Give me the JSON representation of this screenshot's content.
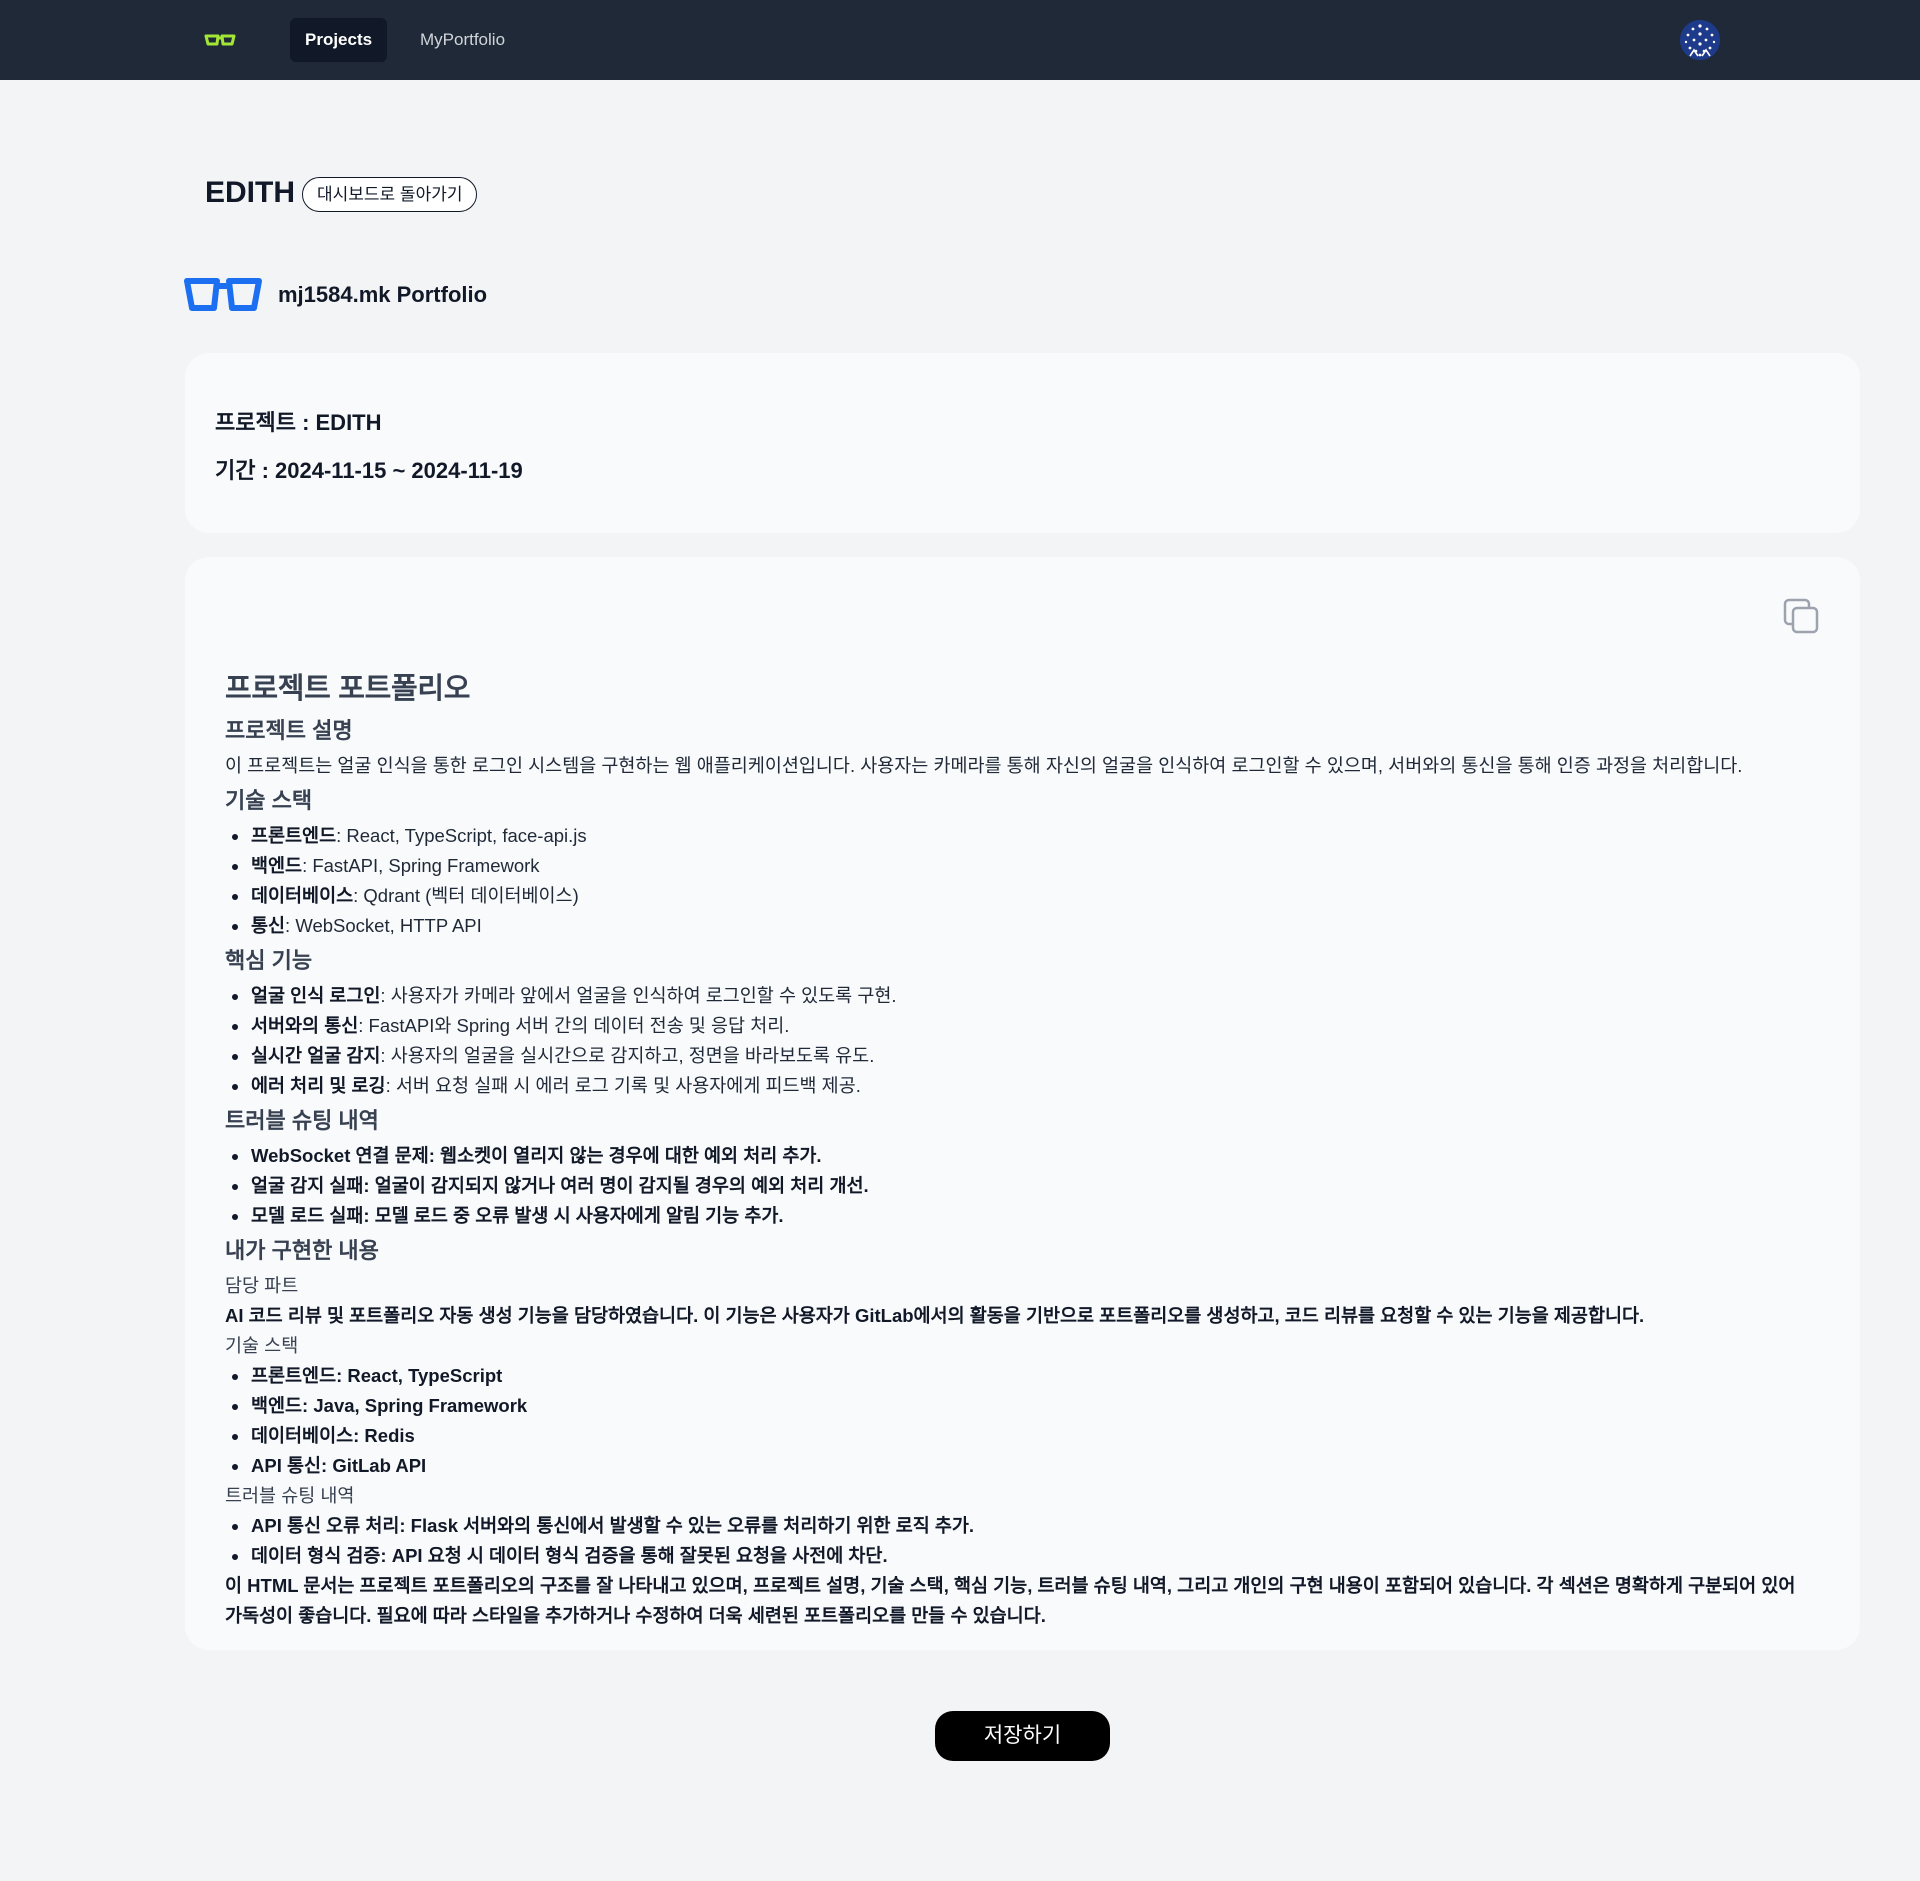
{
  "nav": {
    "tabs": [
      {
        "label": "Projects",
        "active": true
      },
      {
        "label": "MyPortfolio",
        "active": false
      }
    ],
    "logo_icon": "glasses-icon",
    "accent_color": "#a3e635"
  },
  "header": {
    "title": "EDITH",
    "back_label": "대시보드로 돌아가기",
    "portfolio_name": "mj1584.mk Portfolio",
    "brand_icon_color": "#1d6ff2"
  },
  "project_info": {
    "project_line": "프로젝트 : EDITH",
    "period_line": "기간 : 2024-11-15 ~ 2024-11-19"
  },
  "portfolio": {
    "title": "프로젝트 포트폴리오",
    "description_heading": "프로젝트 설명",
    "description": "이 프로젝트는 얼굴 인식을 통한 로그인 시스템을 구현하는 웹 애플리케이션입니다. 사용자는 카메라를 통해 자신의 얼굴을 인식하여 로그인할 수 있으며, 서버와의 통신을 통해 인증 과정을 처리합니다.",
    "stack_heading": "기술 스택",
    "stack": [
      {
        "label": "프론트엔드",
        "value": ": React, TypeScript, face-api.js"
      },
      {
        "label": "백엔드",
        "value": ": FastAPI, Spring Framework"
      },
      {
        "label": "데이터베이스",
        "value": ": Qdrant (벡터 데이터베이스)"
      },
      {
        "label": "통신",
        "value": ": WebSocket, HTTP API"
      }
    ],
    "features_heading": "핵심 기능",
    "features": [
      {
        "label": "얼굴 인식 로그인",
        "value": ": 사용자가 카메라 앞에서 얼굴을 인식하여 로그인할 수 있도록 구현."
      },
      {
        "label": "서버와의 통신",
        "value": ": FastAPI와 Spring 서버 간의 데이터 전송 및 응답 처리."
      },
      {
        "label": "실시간 얼굴 감지",
        "value": ": 사용자의 얼굴을 실시간으로 감지하고, 정면을 바라보도록 유도."
      },
      {
        "label": "에러 처리 및 로깅",
        "value": ": 서버 요청 실패 시 에러 로그 기록 및 사용자에게 피드백 제공."
      }
    ],
    "troubleshooting_heading": "트러블 슈팅 내역",
    "troubleshooting": [
      "WebSocket 연결 문제: 웹소켓이 열리지 않는 경우에 대한 예외 처리 추가.",
      "얼굴 감지 실패: 얼굴이 감지되지 않거나 여러 명이 감지될 경우의 예외 처리 개선.",
      "모델 로드 실패: 모델 로드 중 오류 발생 시 사용자에게 알림 기능 추가."
    ],
    "my_work_heading": "내가 구현한 내용",
    "part_label": "담당 파트",
    "part_text": "AI 코드 리뷰 및 포트폴리오 자동 생성 기능을 담당하였습니다. 이 기능은 사용자가 GitLab에서의 활동을 기반으로 포트폴리오를 생성하고, 코드 리뷰를 요청할 수 있는 기능을 제공합니다.",
    "my_stack_label": "기술 스택",
    "my_stack": [
      "프론트엔드: React, TypeScript",
      "백엔드: Java, Spring Framework",
      "데이터베이스: Redis",
      "API 통신: GitLab API"
    ],
    "my_trouble_label": "트러블 슈팅 내역",
    "my_trouble": [
      "API 통신 오류 처리: Flask 서버와의 통신에서 발생할 수 있는 오류를 처리하기 위한 로직 추가.",
      "데이터 형식 검증: API 요청 시 데이터 형식 검증을 통해 잘못된 요청을 사전에 차단."
    ],
    "closing": "이 HTML 문서는 프로젝트 포트폴리오의 구조를 잘 나타내고 있으며, 프로젝트 설명, 기술 스택, 핵심 기능, 트러블 슈팅 내역, 그리고 개인의 구현 내용이 포함되어 있습니다. 각 섹션은 명확하게 구분되어 있어 가독성이 좋습니다. 필요에 따라 스타일을 추가하거나 수정하여 더욱 세련된 포트폴리오를 만들 수 있습니다."
  },
  "copy_icon": "copy-icon",
  "save_label": "저장하기"
}
